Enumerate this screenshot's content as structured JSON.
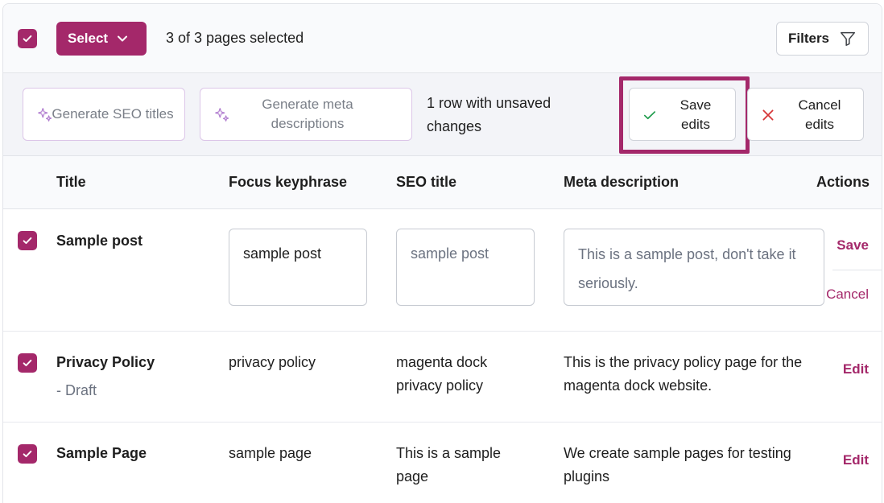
{
  "topbar": {
    "select_label": "Select",
    "selection_count": "3 of 3 pages selected",
    "filters_label": "Filters"
  },
  "actionbar": {
    "generate_titles_label": "Generate SEO titles",
    "generate_meta_label": "Generate meta descriptions",
    "unsaved_status": "1 row with unsaved changes",
    "save_label": "Save edits",
    "cancel_label": "Cancel edits"
  },
  "table": {
    "headers": {
      "title": "Title",
      "focus_keyphrase": "Focus keyphrase",
      "seo_title": "SEO title",
      "meta_description": "Meta description",
      "actions": "Actions"
    },
    "rows": [
      {
        "title": "Sample post",
        "focus_keyphrase": "sample post",
        "seo_title_placeholder": "sample post",
        "meta_description": "This is a sample post, don't take it seriously.",
        "action_save": "Save",
        "action_cancel": "Cancel"
      },
      {
        "title": "Privacy Policy",
        "status": "- Draft",
        "focus_keyphrase": "privacy policy",
        "seo_title": "magenta dock privacy policy",
        "meta_description": "This is the privacy policy page for the magenta dock website.",
        "action_edit": "Edit"
      },
      {
        "title": "Sample Page",
        "focus_keyphrase": "sample page",
        "seo_title": "This is a sample page",
        "meta_description": "We create sample pages for testing plugins",
        "action_edit": "Edit"
      }
    ]
  },
  "icons": {
    "checkbox": "check-icon",
    "select_dropdown": "chevron-down-icon",
    "filters": "funnel-icon",
    "generate": "sparkles-icon",
    "save": "check-icon",
    "cancel": "x-icon"
  },
  "colors": {
    "brand": "#a4286a",
    "save_check": "#1d9b4a",
    "cancel_x": "#d63638"
  }
}
